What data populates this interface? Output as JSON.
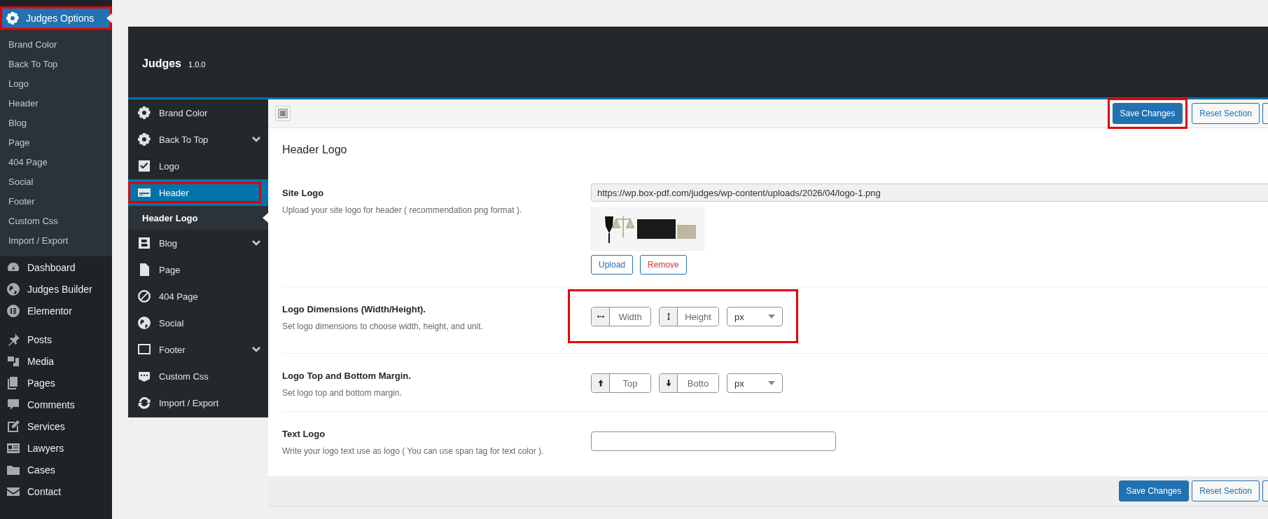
{
  "admin_menu": {
    "current": {
      "label": "Judges Options",
      "annotated": true
    },
    "submenu": [
      "Brand Color",
      "Back To Top",
      "Logo",
      "Header",
      "Blog",
      "Page",
      "404 Page",
      "Social",
      "Footer",
      "Custom Css",
      "Import / Export"
    ],
    "items": [
      "Dashboard",
      "Judges Builder",
      "Elementor",
      "Posts",
      "Media",
      "Pages",
      "Comments",
      "Services",
      "Lawyers",
      "Cases",
      "Contact"
    ]
  },
  "options_panel": {
    "title": "Judges",
    "version": "1.0.0",
    "nav": [
      {
        "label": "Brand Color",
        "selected": false,
        "expandable": false,
        "annotated": false
      },
      {
        "label": "Back To Top",
        "selected": false,
        "expandable": true,
        "annotated": false
      },
      {
        "label": "Logo",
        "selected": false,
        "expandable": false,
        "annotated": false
      },
      {
        "label": "Header",
        "selected": true,
        "expandable": false,
        "annotated": true,
        "children": [
          {
            "label": "Header Logo",
            "selected": true
          }
        ]
      },
      {
        "label": "Blog",
        "selected": false,
        "expandable": true,
        "annotated": false
      },
      {
        "label": "Page",
        "selected": false,
        "expandable": false,
        "annotated": false
      },
      {
        "label": "404 Page",
        "selected": false,
        "expandable": false,
        "annotated": false
      },
      {
        "label": "Social",
        "selected": false,
        "expandable": false,
        "annotated": false
      },
      {
        "label": "Footer",
        "selected": false,
        "expandable": true,
        "annotated": false
      },
      {
        "label": "Custom Css",
        "selected": false,
        "expandable": false,
        "annotated": false
      },
      {
        "label": "Import / Export",
        "selected": false,
        "expandable": false,
        "annotated": false
      }
    ],
    "toolbar_buttons": [
      {
        "label": "Save Changes",
        "kind": "primary",
        "annotated": true
      },
      {
        "label": "Reset Section",
        "kind": "secondary"
      }
    ],
    "section_title": "Header Logo",
    "fields": [
      {
        "kind": "media",
        "label": "Site Logo",
        "description": "Upload your site logo for header ( recommendation png format ).",
        "value": "https://wp.box-pdf.com/judges/wp-content/uploads/2026/04/logo-1.png",
        "buttons": [
          {
            "label": "Upload",
            "kind": "upload"
          },
          {
            "label": "Remove",
            "kind": "remove"
          }
        ]
      },
      {
        "kind": "dimensions",
        "label": "Logo Dimensions (Width/Height).",
        "description": "Set logo dimensions to choose width, height, and unit.",
        "annotated": true,
        "inputs": [
          {
            "placeholder": "Width"
          },
          {
            "placeholder": "Height"
          }
        ],
        "unit": "px"
      },
      {
        "kind": "dimensions",
        "label": "Logo Top and Bottom Margin.",
        "description": "Set logo top and bottom margin.",
        "annotated": false,
        "inputs": [
          {
            "placeholder": "Top"
          },
          {
            "placeholder": "Botto"
          }
        ],
        "unit": "px"
      },
      {
        "kind": "text",
        "label": "Text Logo",
        "description": "Write your logo text use as logo ( You can use span tag for text color )."
      }
    ],
    "footer_buttons": [
      {
        "label": "Save Changes",
        "kind": "primary"
      },
      {
        "label": "Reset Section",
        "kind": "secondary"
      }
    ]
  }
}
